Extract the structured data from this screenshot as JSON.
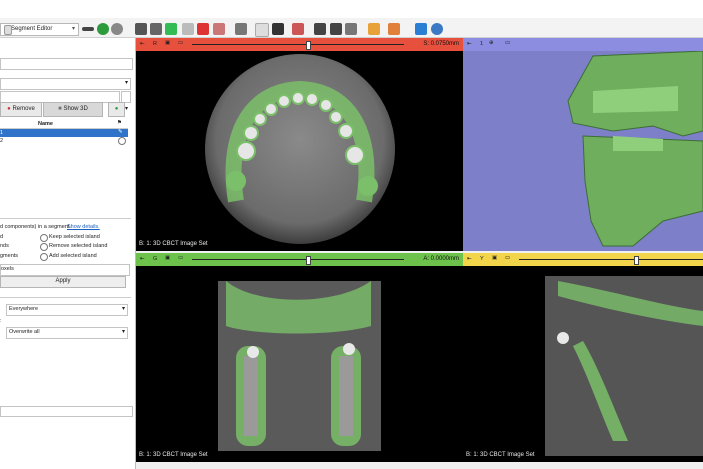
{
  "toolbar": {
    "module_name": "Segment Editor",
    "icons": [
      "module-menu-icon",
      "history-back-icon",
      "history-forward-icon",
      "volumes-icon",
      "models-icon",
      "segment-editor-icon",
      "markups-icon",
      "data-icon",
      "volume-rendering-icon",
      "pointer-icon",
      "place-fiducial-icon",
      "layout-icon",
      "screenshot-icon",
      "camera-icon",
      "crosshair-icon",
      "extensions-icon",
      "python-icon"
    ]
  },
  "left_panel": {
    "remove_label": "Remove",
    "show3d_label": "Show 3D",
    "table_header_name": "Name",
    "segments": [
      {
        "name": "1",
        "color": "#2b6fd6",
        "selected": true
      },
      {
        "name": "2",
        "color": "#ffffff",
        "selected": false
      }
    ],
    "islands_desc": "d components) in a segment.",
    "show_details": "Show details.",
    "opt_left": [
      "d",
      "nds",
      "gments"
    ],
    "opt_right": [
      "Keep selected island",
      "Remove selected island",
      "Add selected island"
    ],
    "voxels_label": "oxels",
    "apply_label": "Apply",
    "editable_area": "Everywhere",
    "overwrite_label": ":",
    "overwrite_value": "Overwrite all"
  },
  "views": {
    "red": {
      "offset": "S: 0.0750mm",
      "label": "B: 1: 3D CBCT Image Set",
      "letter": "R",
      "number": "1"
    },
    "threed": {
      "number": "1"
    },
    "green": {
      "offset": "A: 0.0000mm",
      "label": "B: 1: 3D CBCT Image Set",
      "letter": "G"
    },
    "yellow": {
      "offset": "",
      "label": "B: 1: 3D CBCT Image Set",
      "letter": "Y"
    }
  },
  "colors": {
    "red_bar": "#e6503c",
    "green_bar": "#6cc24a",
    "yellow_bar": "#f2d54a",
    "blue_bar": "#8c8ce0",
    "segment_green": "#7bbf6a",
    "bg3d": "#7d7fc9"
  }
}
